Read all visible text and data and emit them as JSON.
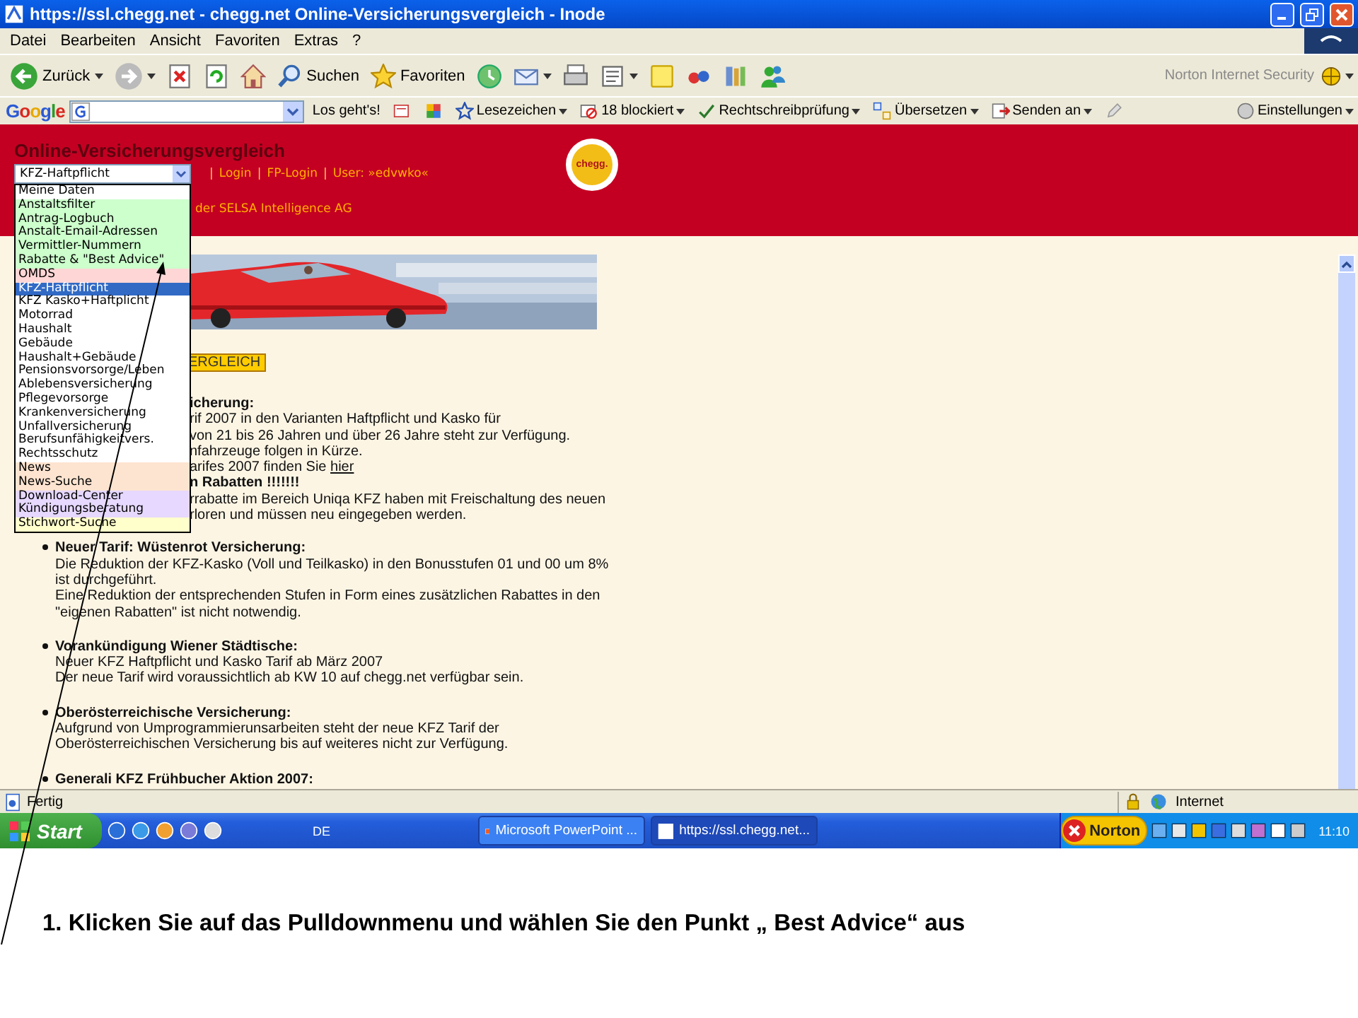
{
  "window": {
    "title": "https://ssl.chegg.net - chegg.net Online-Versicherungsvergleich - Inode"
  },
  "menu_bar": [
    "Datei",
    "Bearbeiten",
    "Ansicht",
    "Favoriten",
    "Extras",
    "?"
  ],
  "toolbar": {
    "items": [
      {
        "kind": "back",
        "label": "Zurück"
      },
      {
        "kind": "forward"
      },
      {
        "kind": "stop"
      },
      {
        "kind": "refresh"
      },
      {
        "kind": "home"
      },
      {
        "kind": "search",
        "label": "Suchen"
      },
      {
        "kind": "favorites",
        "label": "Favoriten"
      },
      {
        "kind": "history"
      },
      {
        "kind": "mail"
      },
      {
        "kind": "print"
      },
      {
        "kind": "edit"
      },
      {
        "kind": "note"
      },
      {
        "kind": "shop"
      },
      {
        "kind": "research"
      },
      {
        "kind": "messenger"
      }
    ],
    "security": "Norton Internet Security"
  },
  "google_bar": {
    "logo": "Google",
    "button": "Los geht's!",
    "items": [
      {
        "kind": "popup"
      },
      {
        "kind": "puzzle"
      },
      {
        "kind": "bookmarks",
        "label": "Lesezeichen"
      },
      {
        "kind": "blocked",
        "label": "18 blockiert"
      },
      {
        "kind": "spell",
        "label": "Rechtschreibprüfung"
      },
      {
        "kind": "translate",
        "label": "Übersetzen"
      },
      {
        "kind": "send",
        "label": "Senden an"
      },
      {
        "kind": "pencil"
      }
    ],
    "settings": "Einstellungen"
  },
  "page": {
    "title": "Online-Versicherungsvergleich",
    "selector": {
      "value": "KFZ-Haftpflicht",
      "expanded": true,
      "options": [
        {
          "label": "Meine Daten",
          "color": "#ffffff",
          "selected": false
        },
        {
          "label": "Anstaltsfilter",
          "color": "#ccffcc",
          "selected": false
        },
        {
          "label": "Antrag-Logbuch",
          "color": "#ccffcc",
          "selected": false
        },
        {
          "label": "Anstalt-Email-Adressen",
          "color": "#ccffcc",
          "selected": false
        },
        {
          "label": "Vermittler-Nummern",
          "color": "#ccffcc",
          "selected": false
        },
        {
          "label": "Rabatte & \"Best Advice\"",
          "color": "#ccffcc",
          "selected": false
        },
        {
          "label": "OMDS",
          "color": "#ffd6d6",
          "selected": false
        },
        {
          "label": "KFZ-Haftpflicht",
          "selected": true
        },
        {
          "label": "KFZ Kasko+Haftplicht",
          "color": "#ffffff",
          "selected": false
        },
        {
          "label": "Motorrad",
          "color": "#ffffff",
          "selected": false
        },
        {
          "label": "Haushalt",
          "color": "#ffffff",
          "selected": false
        },
        {
          "label": "Gebäude",
          "color": "#ffffff",
          "selected": false
        },
        {
          "label": "Haushalt+Gebäude",
          "color": "#ffffff",
          "selected": false
        },
        {
          "label": "Pensionsvorsorge/Leben",
          "color": "#ffffff",
          "selected": false
        },
        {
          "label": "Ablebensversicherung",
          "color": "#ffffff",
          "selected": false
        },
        {
          "label": "Pflegevorsorge",
          "color": "#ffffff",
          "selected": false
        },
        {
          "label": "Krankenversicherung",
          "color": "#ffffff",
          "selected": false
        },
        {
          "label": "Unfallversicherung",
          "color": "#ffffff",
          "selected": false
        },
        {
          "label": "Berufsunfähigkeitvers.",
          "color": "#ffffff",
          "selected": false
        },
        {
          "label": "Rechtsschutz",
          "color": "#ffffff",
          "selected": false
        },
        {
          "label": "News",
          "color": "#fde4d0",
          "selected": false
        },
        {
          "label": "News-Suche",
          "color": "#fde4d0",
          "selected": false
        },
        {
          "label": "Download-Center",
          "color": "#e6d8ff",
          "selected": false
        },
        {
          "label": "Kündigungsberatung",
          "color": "#e6d8ff",
          "selected": false
        },
        {
          "label": "Stichwort-Suche",
          "color": "#ffffcc",
          "selected": false
        }
      ]
    },
    "nav": [
      {
        "kind": "separator",
        "text": "|"
      },
      {
        "kind": "link",
        "text": "Login"
      },
      {
        "kind": "separator",
        "text": "|"
      },
      {
        "kind": "link",
        "text": "FP-Login"
      },
      {
        "kind": "separator",
        "text": "|"
      },
      {
        "kind": "text",
        "text": "User: »edvwko«"
      }
    ],
    "credit": "der SELSA Intelligence AG",
    "logo": "chegg.",
    "compare_button": "ERGLEICH",
    "partial_block": [
      {
        "kind": "heading",
        "text": "icherung:"
      },
      {
        "kind": "text",
        "text": "rif 2007 in den Varianten Haftpflicht und Kasko für"
      },
      {
        "kind": "text",
        "text": "von 21 bis 26 Jahren und über 26 Jahre steht zur Verfügung."
      },
      {
        "kind": "text",
        "text": "nfahrzeuge folgen in Kürze."
      },
      {
        "kind": "text",
        "text": "arifes 2007 finden Sie",
        "link": "hier"
      },
      {
        "kind": "heading",
        "text": "n Rabatten !!!!!!!"
      },
      {
        "kind": "text",
        "text": "rrabatte im Bereich Uniqa KFZ haben mit Freischaltung des neuen"
      },
      {
        "kind": "text",
        "text": "rloren und müssen neu eingegeben werden."
      }
    ],
    "news": [
      {
        "title": "Neuer Tarif: Wüstenrot Versicherung:",
        "paragraphs": [
          "Die Reduktion der KFZ-Kasko (Voll und Teilkasko) in den Bonusstufen 01 und 00 um 8% ist durchgeführt.",
          "Eine Reduktion der entsprechenden Stufen in Form eines zusätzlichen Rabattes in den \"eigenen Rabatten\" ist nicht notwendig."
        ]
      },
      {
        "title": "Vorankündigung Wiener Städtische:",
        "paragraphs": [
          "Neuer KFZ Haftpflicht und Kasko Tarif ab März 2007",
          "Der neue Tarif wird voraussichtlich ab KW 10 auf chegg.net verfügbar sein."
        ]
      },
      {
        "title": "Oberösterreichische Versicherung:",
        "paragraphs": [
          "Aufgrund von Umprogrammierunsarbeiten steht der neue KFZ Tarif der Oberösterreichischen Versicherung bis auf weiteres nicht zur Verfügung."
        ]
      },
      {
        "title": "Generali KFZ Frühbucher Aktion 2007:"
      }
    ]
  },
  "status_bar": {
    "text": "Fertig",
    "zone": "Internet"
  },
  "taskbar": {
    "start": "Start",
    "language": "DE",
    "tasks": [
      {
        "label": "Microsoft PowerPoint ...",
        "selected": false
      },
      {
        "label": "https://ssl.chegg.net...",
        "selected": true
      }
    ],
    "norton": "Norton",
    "clock": "11:10"
  },
  "caption": "1. Klicken Sie auf das Pulldownmenu und wählen Sie den Punkt „ Best Advice“ aus"
}
